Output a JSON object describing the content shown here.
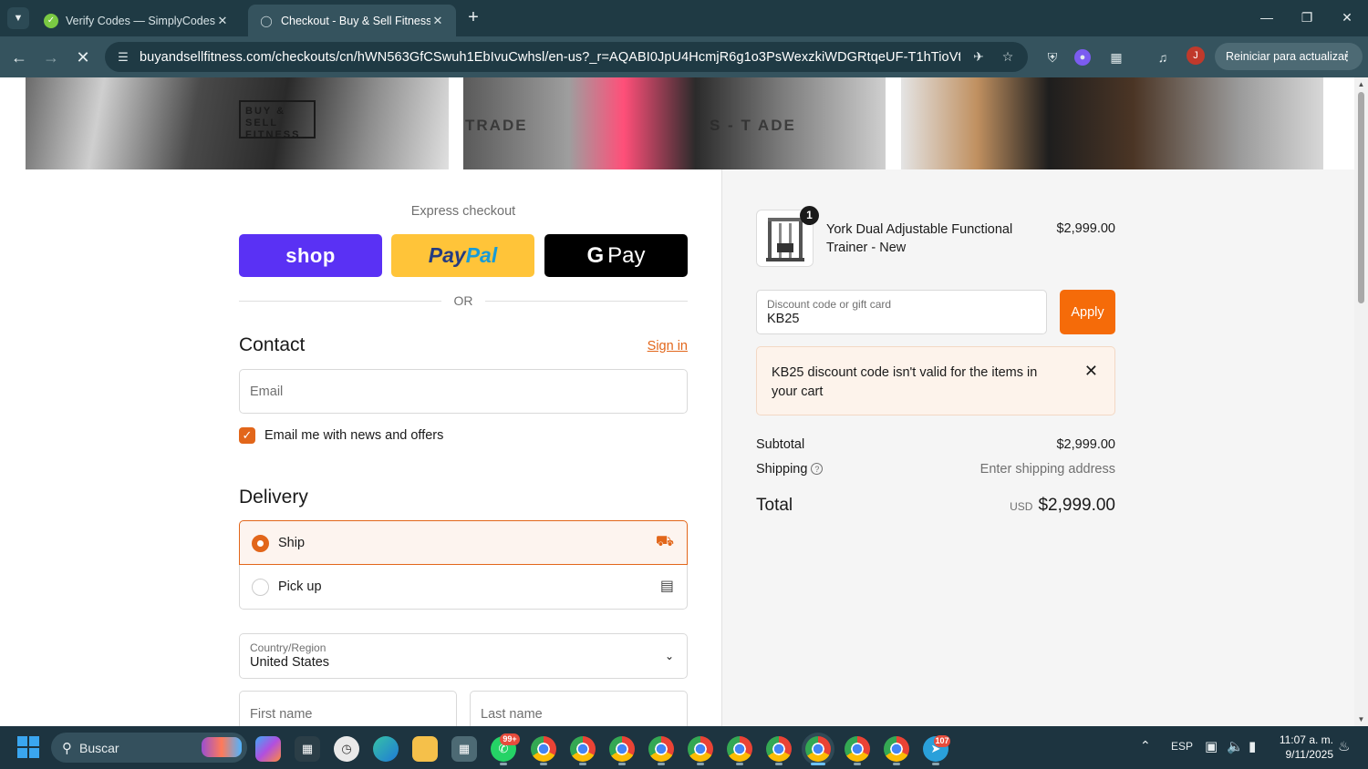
{
  "browser": {
    "tabs": [
      {
        "title": "Verify Codes — SimplyCodes",
        "active": false
      },
      {
        "title": "Checkout - Buy & Sell Fitness",
        "active": true
      }
    ],
    "url": "buyandsellfitness.com/checkouts/cn/hWN563GfCSwuh1EbIvuCwhsl/en-us?_r=AQABI0JpU4HcmjR6g1o3PsWexzkiWDGRtqeUF-T1hTioVtw&skip_sho...",
    "profile_initial": "J",
    "update_label": "Reiniciar para actualizar"
  },
  "banner": {
    "logo_text": "BUY & SELL FITNESS",
    "photo_text_1": "TRADE",
    "photo_text_2": "S - T ADE"
  },
  "checkout": {
    "express_label": "Express checkout",
    "pay_buttons": {
      "shop": "shop",
      "paypal_a": "Pay",
      "paypal_b": "Pal",
      "gpay_g": "G",
      "gpay_text": "Pay"
    },
    "or_label": "OR",
    "contact": {
      "heading": "Contact",
      "sign_in": "Sign in",
      "email_placeholder": "Email",
      "newsletter_label": "Email me with news and offers",
      "newsletter_checked": true
    },
    "delivery": {
      "heading": "Delivery",
      "options": [
        {
          "label": "Ship",
          "selected": true,
          "icon": "truck-icon"
        },
        {
          "label": "Pick up",
          "selected": false,
          "icon": "store-icon"
        }
      ],
      "country_label": "Country/Region",
      "country_value": "United States",
      "first_name_placeholder": "First name",
      "last_name_placeholder": "Last name"
    }
  },
  "summary": {
    "product": {
      "quantity": "1",
      "name": "York Dual Adjustable Functional Trainer - New",
      "price": "$2,999.00"
    },
    "discount": {
      "label": "Discount code or gift card",
      "value": "KB25",
      "apply_label": "Apply",
      "error": "KB25 discount code isn't valid for the items in your cart"
    },
    "subtotal_label": "Subtotal",
    "subtotal_value": "$2,999.00",
    "shipping_label": "Shipping",
    "shipping_value": "Enter shipping address",
    "total_label": "Total",
    "total_currency": "USD",
    "total_value": "$2,999.00"
  },
  "taskbar": {
    "search_label": "Buscar",
    "whatsapp_badge": "99+",
    "telegram_badge": "107",
    "language": "ESP",
    "time": "11:07 a. m.",
    "date": "9/11/2025"
  },
  "colors": {
    "accent": "#e2661a",
    "apply_button": "#f56b09",
    "shop_pay": "#5a31f4",
    "paypal": "#ffc439"
  }
}
